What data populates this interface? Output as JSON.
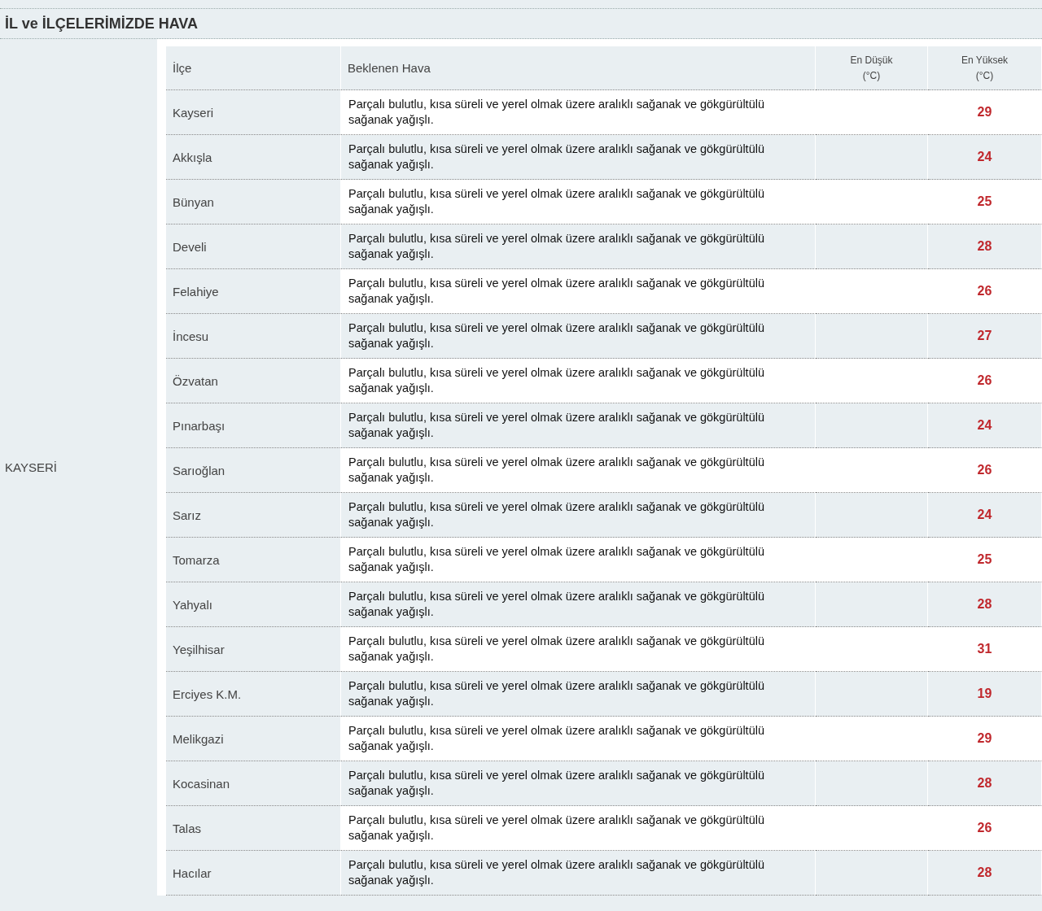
{
  "section_title": "İL ve İLÇELERİMİZDE HAVA",
  "province": "KAYSERİ",
  "table": {
    "columns": [
      "İlçe",
      "Beklenen Hava",
      "En Düşük\n(°C)",
      "En Yüksek\n(°C)"
    ],
    "rows": [
      {
        "district": "Kayseri",
        "forecast": "Parçalı bulutlu, kısa süreli ve yerel olmak üzere aralıklı sağanak ve gökgürültülü sağanak yağışlı.",
        "high": "29"
      },
      {
        "district": "Akkışla",
        "forecast": "Parçalı bulutlu, kısa süreli ve yerel olmak üzere aralıklı sağanak ve gökgürültülü sağanak yağışlı.",
        "high": "24"
      },
      {
        "district": "Bünyan",
        "forecast": "Parçalı bulutlu, kısa süreli ve yerel olmak üzere aralıklı sağanak ve gökgürültülü sağanak yağışlı.",
        "high": "25"
      },
      {
        "district": "Develi",
        "forecast": "Parçalı bulutlu, kısa süreli ve yerel olmak üzere aralıklı sağanak ve gökgürültülü sağanak yağışlı.",
        "high": "28"
      },
      {
        "district": "Felahiye",
        "forecast": "Parçalı bulutlu, kısa süreli ve yerel olmak üzere aralıklı sağanak ve gökgürültülü sağanak yağışlı.",
        "high": "26"
      },
      {
        "district": "İncesu",
        "forecast": "Parçalı bulutlu, kısa süreli ve yerel olmak üzere aralıklı sağanak ve gökgürültülü sağanak yağışlı.",
        "high": "27"
      },
      {
        "district": "Özvatan",
        "forecast": "Parçalı bulutlu, kısa süreli ve yerel olmak üzere aralıklı sağanak ve gökgürültülü sağanak yağışlı.",
        "high": "26"
      },
      {
        "district": "Pınarbaşı",
        "forecast": "Parçalı bulutlu, kısa süreli ve yerel olmak üzere aralıklı sağanak ve gökgürültülü sağanak yağışlı.",
        "high": "24"
      },
      {
        "district": "Sarıoğlan",
        "forecast": "Parçalı bulutlu, kısa süreli ve yerel olmak üzere aralıklı sağanak ve gökgürültülü sağanak yağışlı.",
        "high": "26"
      },
      {
        "district": "Sarız",
        "forecast": "Parçalı bulutlu, kısa süreli ve yerel olmak üzere aralıklı sağanak ve gökgürültülü sağanak yağışlı.",
        "high": "24"
      },
      {
        "district": "Tomarza",
        "forecast": "Parçalı bulutlu, kısa süreli ve yerel olmak üzere aralıklı sağanak ve gökgürültülü sağanak yağışlı.",
        "high": "25"
      },
      {
        "district": "Yahyalı",
        "forecast": "Parçalı bulutlu, kısa süreli ve yerel olmak üzere aralıklı sağanak ve gökgürültülü sağanak yağışlı.",
        "high": "28"
      },
      {
        "district": "Yeşilhisar",
        "forecast": "Parçalı bulutlu, kısa süreli ve yerel olmak üzere aralıklı sağanak ve gökgürültülü sağanak yağışlı.",
        "high": "31"
      },
      {
        "district": "Erciyes K.M.",
        "forecast": "Parçalı bulutlu, kısa süreli ve yerel olmak üzere aralıklı sağanak ve gökgürültülü sağanak yağışlı.",
        "high": "19"
      },
      {
        "district": "Melikgazi",
        "forecast": "Parçalı bulutlu, kısa süreli ve yerel olmak üzere aralıklı sağanak ve gökgürültülü sağanak yağışlı.",
        "high": "29"
      },
      {
        "district": "Kocasinan",
        "forecast": "Parçalı bulutlu, kısa süreli ve yerel olmak üzere aralıklı sağanak ve gökgürültülü sağanak yağışlı.",
        "high": "28"
      },
      {
        "district": "Talas",
        "forecast": "Parçalı bulutlu, kısa süreli ve yerel olmak üzere aralıklı sağanak ve gökgürültülü sağanak yağışlı.",
        "high": "26"
      },
      {
        "district": "Hacılar",
        "forecast": "Parçalı bulutlu, kısa süreli ve yerel olmak üzere aralıklı sağanak ve gökgürültülü sağanak yağışlı.",
        "high": "28"
      }
    ]
  }
}
